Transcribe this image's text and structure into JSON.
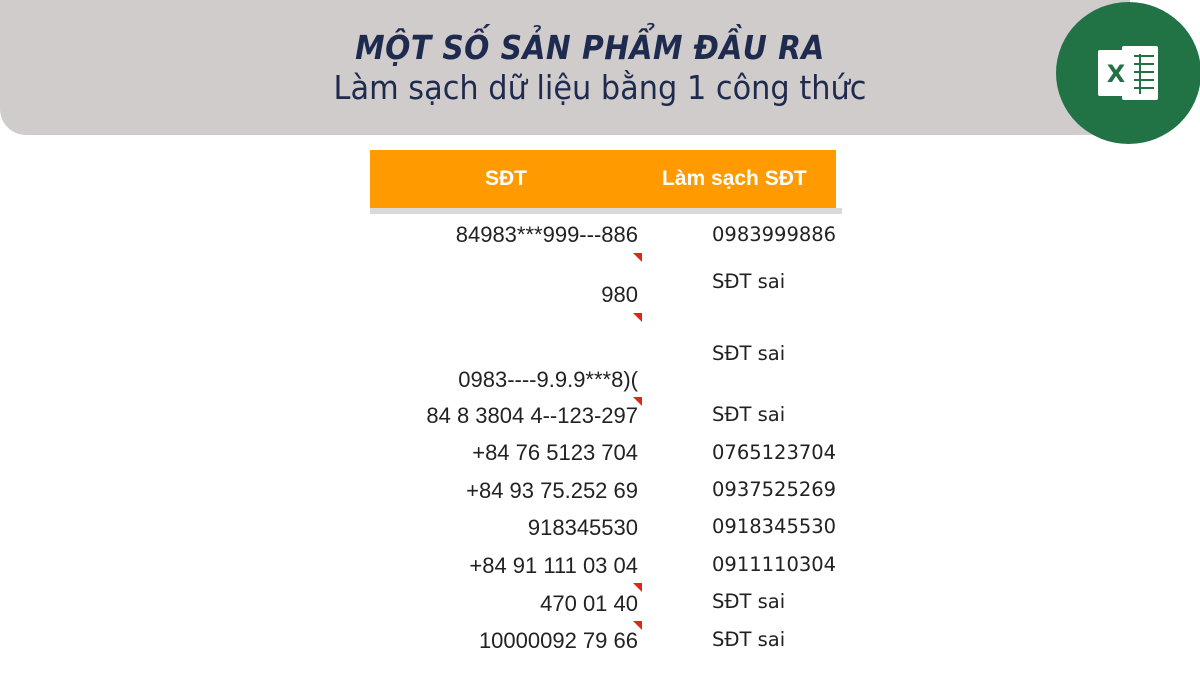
{
  "header": {
    "title": "MỘT SỐ SẢN PHẨM ĐẦU RA",
    "subtitle": "Làm sạch dữ liệu bằng 1 công thức"
  },
  "logo": {
    "icon": "excel-logo-icon",
    "letter": "X",
    "color": "#217346"
  },
  "table": {
    "header_color": "#ff9a00",
    "columns": [
      "SĐT",
      "Làm sạch SĐT"
    ],
    "rows": [
      {
        "raw": "84983***999---886",
        "clean": "0983999886"
      },
      {
        "raw": "980",
        "clean": "SĐT sai"
      },
      {
        "raw": "0983----9.9.9***8)(",
        "clean": "SĐT sai"
      },
      {
        "raw": "84 8 3804 4--123-297",
        "clean": "SĐT sai"
      },
      {
        "raw": "+84 76 5123 704",
        "clean": "0765123704"
      },
      {
        "raw": "+84 93 75.252 69",
        "clean": "0937525269"
      },
      {
        "raw": "918345530",
        "clean": "0918345530"
      },
      {
        "raw": "+84 91 111 03 04",
        "clean": "0911110304"
      },
      {
        "raw": "470 01 40",
        "clean": "SĐT sai"
      },
      {
        "raw": "10000092 79 66",
        "clean": "SĐT sai"
      }
    ]
  }
}
